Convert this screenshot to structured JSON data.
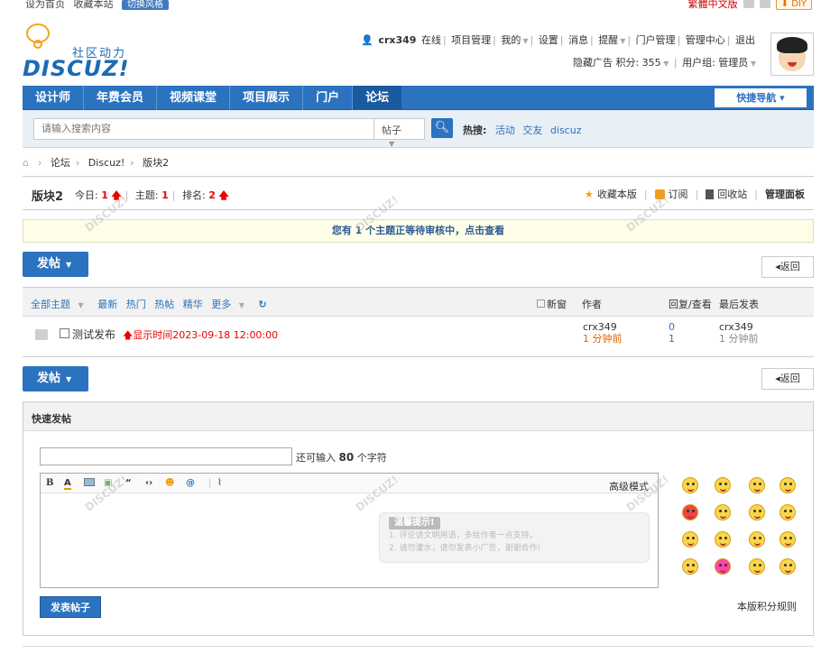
{
  "topbar": {
    "set_home": "设为首页",
    "bookmark": "收藏本站",
    "fav_btn": "切换风格",
    "lang": "繁體中文版",
    "diy": "DIY"
  },
  "logo": {
    "cn": "社区动力",
    "en": "DISCUZ!"
  },
  "user": {
    "name": "crx349",
    "status": "在线",
    "links": [
      "项目管理",
      "我的",
      "设置",
      "消息",
      "提醒",
      "门户管理",
      "管理中心",
      "退出"
    ],
    "hide_ads": "隐藏广告",
    "credits": "积分: 355",
    "group": "用户组: 管理员"
  },
  "nav": {
    "items": [
      "设计师",
      "年费会员",
      "视频课堂",
      "项目展示",
      "门户",
      "论坛"
    ],
    "quick": "快捷导航"
  },
  "search": {
    "placeholder": "请输入搜索内容",
    "type": "帖子",
    "hot_label": "热搜:",
    "hot": [
      "活动",
      "交友",
      "discuz"
    ]
  },
  "breadcrumb": [
    "论坛",
    "Discuz!",
    "版块2"
  ],
  "forum": {
    "title": "版块2",
    "today_label": "今日:",
    "today": "1",
    "topics_label": "主题:",
    "topics": "1",
    "rank_label": "排名:",
    "rank": "2",
    "favorite": "收藏本版",
    "subscribe": "订阅",
    "recycle": "回收站",
    "manage": "管理面板"
  },
  "notice": "您有 1 个主题正等待审核中，点击查看",
  "post_btn": "发帖",
  "back_btn": "返回",
  "thread_list": {
    "tabs": [
      "全部主题",
      "最新",
      "热门",
      "热帖",
      "精华",
      "更多"
    ],
    "newwin": "新窗",
    "author": "作者",
    "reply": "回复/查看",
    "last": "最后发表",
    "rows": [
      {
        "subject": "测试发布",
        "time_label": "显示时间2023-09-18 12:00:00",
        "author": "crx349",
        "author_time": "1 分钟前",
        "replies": "0",
        "views": "1",
        "last_user": "crx349",
        "last_time": "1 分钟前"
      }
    ]
  },
  "fastpost": {
    "title": "快速发帖",
    "remain_prefix": "还可输入",
    "remain_num": "80",
    "remain_suffix": "个字符",
    "advanced": "高级模式",
    "tips_title": "温馨提示!",
    "tips_line1": "1. 评论请文明用语，多给作者一点支持。",
    "tips_line2": "2. 请勿灌水，请勿发表小广告，谢谢合作!",
    "submit": "发表帖子",
    "rules": "本版积分规则"
  }
}
